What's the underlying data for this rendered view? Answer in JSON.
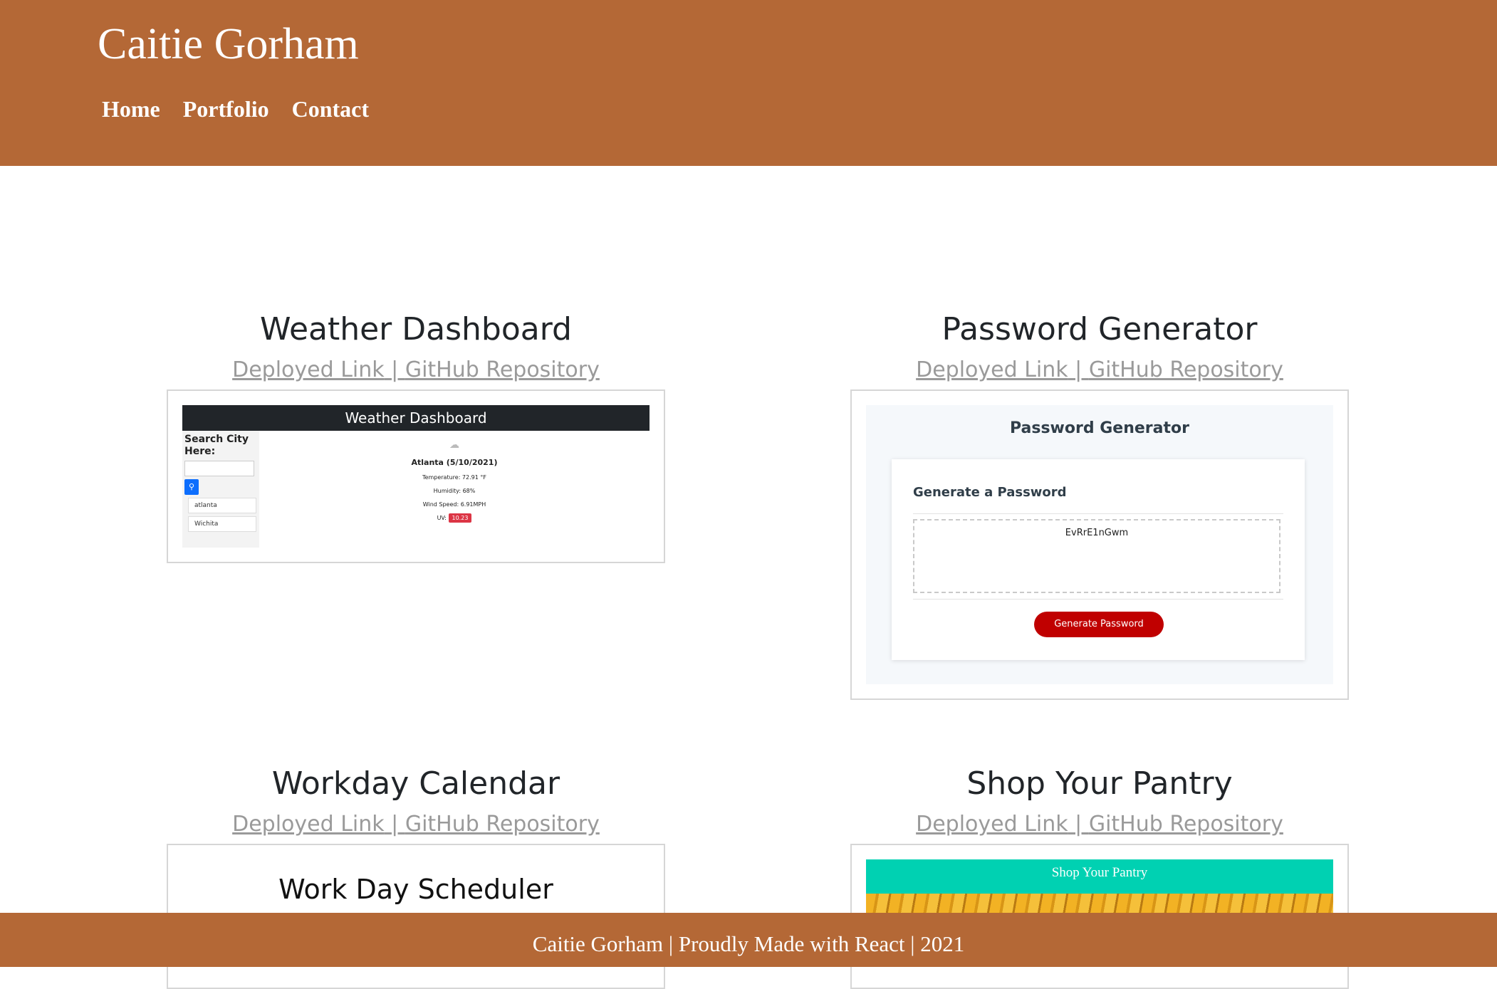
{
  "header": {
    "site_title": "Caitie Gorham",
    "nav": [
      "Home",
      "Portfolio",
      "Contact"
    ]
  },
  "projects": [
    {
      "title": "Weather Dashboard",
      "deployed_label": "Deployed Link",
      "separator": " | ",
      "repo_label": "GitHub Repository",
      "preview": {
        "bar_title": "Weather Dashboard",
        "search_label": "Search City Here:",
        "cities": [
          "atlanta",
          "Wichita"
        ],
        "city_date": "Atlanta (5/10/2021)",
        "temperature": "Temperature: 72.91 °F",
        "humidity": "Humidity: 68%",
        "wind": "Wind Speed: 6.91MPH",
        "uv_label": "UV:",
        "uv_value": "10.23"
      }
    },
    {
      "title": "Password Generator",
      "deployed_label": "Deployed Link",
      "separator": " | ",
      "repo_label": "GitHub Repository",
      "preview": {
        "heading": "Password Generator",
        "subheading": "Generate a Password",
        "password": "EvRrE1nGwm",
        "button": "Generate Password"
      }
    },
    {
      "title": "Workday Calendar",
      "deployed_label": "Deployed Link",
      "separator": " | ",
      "repo_label": "GitHub Repository",
      "preview": {
        "heading": "Work Day Scheduler"
      }
    },
    {
      "title": "Shop Your Pantry",
      "deployed_label": "Deployed Link",
      "separator": " | ",
      "repo_label": "GitHub Repository",
      "preview": {
        "heading": "Shop Your Pantry"
      }
    }
  ],
  "footer": {
    "text": "Caitie Gorham | Proudly Made with React | 2021"
  },
  "colors": {
    "brand": "#b46836",
    "link": "#9a9a9a",
    "pantry_teal": "#00d1b2",
    "button_red": "#c00000"
  }
}
